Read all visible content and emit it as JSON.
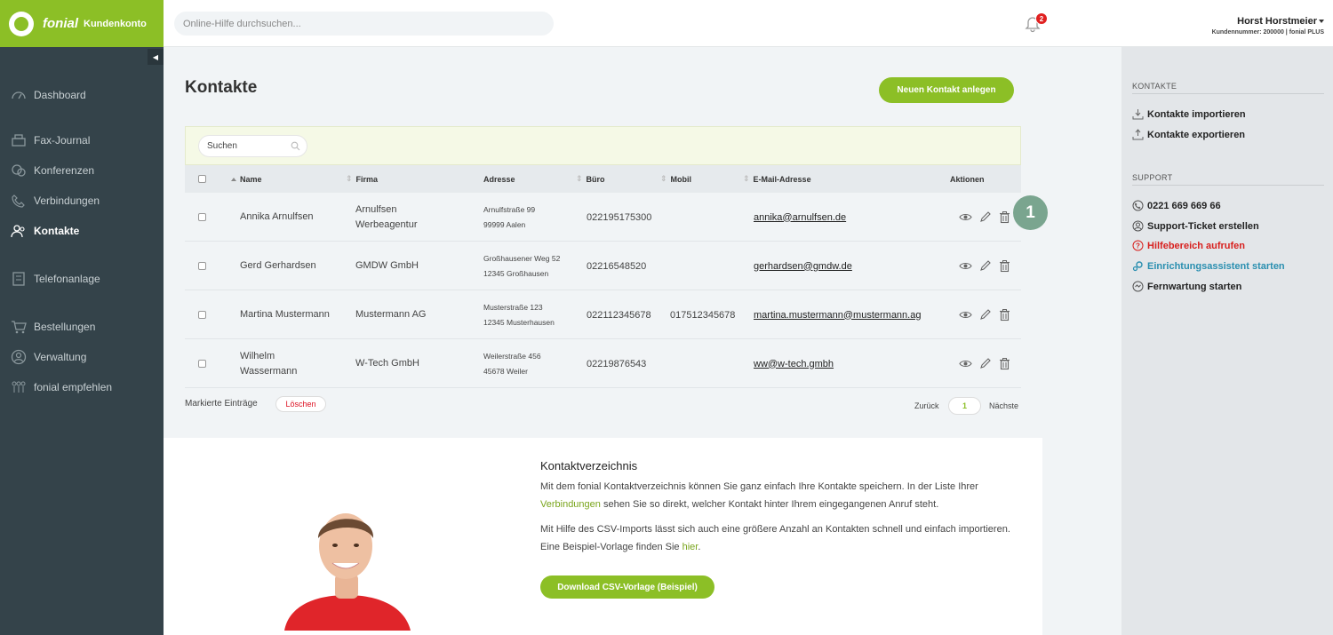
{
  "brand": {
    "name": "fonial",
    "sub": "Kundenkonto"
  },
  "top_search": {
    "placeholder": "Online-Hilfe durchsuchen..."
  },
  "notifications": {
    "count": "2"
  },
  "user": {
    "name": "Horst Horstmeier",
    "sub": "Kundennummer: 200000 | fonial PLUS"
  },
  "sidebar": {
    "items": [
      {
        "label": "Dashboard",
        "icon": "dashboard-icon"
      },
      {
        "label": "Fax-Journal",
        "icon": "fax-icon"
      },
      {
        "label": "Konferenzen",
        "icon": "conference-icon"
      },
      {
        "label": "Verbindungen",
        "icon": "phone-icon"
      },
      {
        "label": "Kontakte",
        "icon": "contacts-icon",
        "active": true
      },
      {
        "label": "Telefonanlage",
        "icon": "pbx-icon"
      },
      {
        "label": "Bestellungen",
        "icon": "cart-icon"
      },
      {
        "label": "Verwaltung",
        "icon": "user-icon"
      },
      {
        "label": "fonial empfehlen",
        "icon": "recommend-icon"
      }
    ]
  },
  "main": {
    "title": "Kontakte",
    "new_button": "Neuen Kontakt anlegen",
    "filter_search": "Suchen",
    "columns": [
      "Name",
      "Firma",
      "Adresse",
      "Büro",
      "Mobil",
      "E-Mail-Adresse",
      "Aktionen"
    ],
    "rows": [
      {
        "name1": "Annika Arnulfsen",
        "name2": "",
        "firma1": "Arnulfsen",
        "firma2": "Werbeagentur",
        "addr1": "Arnulfstraße 99",
        "addr2": "99999 Aalen",
        "buero": "022195175300",
        "mobil": "",
        "email": "annika@arnulfsen.de"
      },
      {
        "name1": "Gerd Gerhardsen",
        "name2": "",
        "firma1": "GMDW GmbH",
        "firma2": "",
        "addr1": "Großhausener Weg 52",
        "addr2": "12345 Großhausen",
        "buero": "02216548520",
        "mobil": "",
        "email": "gerhardsen@gmdw.de"
      },
      {
        "name1": "Martina Mustermann",
        "name2": "",
        "firma1": "Mustermann AG",
        "firma2": "",
        "addr1": "Musterstraße 123",
        "addr2": "12345 Musterhausen",
        "buero": "022112345678",
        "mobil": "017512345678",
        "email": "martina.mustermann@mustermann.ag"
      },
      {
        "name1": "Wilhelm",
        "name2": "Wassermann",
        "firma1": "W-Tech GmbH",
        "firma2": "",
        "addr1": "Weilerstraße 456",
        "addr2": "45678 Weiler",
        "buero": "02219876543",
        "mobil": "",
        "email": "ww@w-tech.gmbh"
      }
    ],
    "step_badge": "1",
    "marked_label": "Markierte Einträge",
    "delete_button": "Löschen",
    "pager": {
      "back": "Zurück",
      "page": "1",
      "next": "Nächste"
    }
  },
  "info": {
    "title": "Kontaktverzeichnis",
    "p1_a": "Mit dem fonial Kontaktverzeichnis können Sie ganz einfach Ihre Kontakte speichern. In der Liste Ihrer",
    "p1_link": "Verbindungen",
    "p1_b": " sehen Sie so direkt, welcher Kontakt hinter Ihrem eingegangenen Anruf steht.",
    "p2_a": "Mit Hilfe des CSV-Imports lässt sich auch eine größere Anzahl an Kontakten schnell und einfach importieren. Eine Beispiel-Vorlage finden Sie ",
    "p2_link": "hier",
    "p2_b": ".",
    "download_button": "Download CSV-Vorlage (Beispiel)"
  },
  "right_panel": {
    "kontakte_head": "KONTAKTE",
    "import": "Kontakte importieren",
    "export": "Kontakte exportieren",
    "support_head": "SUPPORT",
    "phone": "0221 669 669 66",
    "ticket": "Support-Ticket erstellen",
    "help": "Hilfebereich aufrufen",
    "wizard": "Einrichtungsassistent starten",
    "remote": "Fernwartung starten"
  },
  "colors": {
    "accent": "#8cbf26",
    "sidebar": "#34434a",
    "danger": "#d8201e",
    "link_blue": "#2a8fb0"
  }
}
